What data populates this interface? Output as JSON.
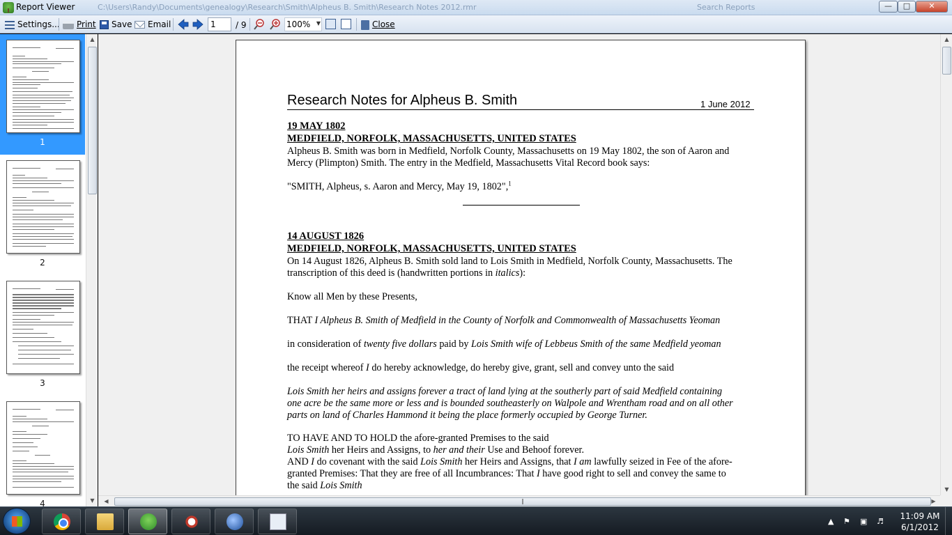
{
  "window": {
    "title": "Report Viewer",
    "path": "C:\\Users\\Randy\\Documents\\genealogy\\Research\\Smith\\Alpheus B. Smith\\Research Notes 2012.rmr",
    "search_text": "Search Reports"
  },
  "toolbar": {
    "settings_label": "Settings...",
    "print_label": "Print",
    "save_label": "Save",
    "email_label": "Email",
    "page_current": "1",
    "page_total": "/ 9",
    "zoom": "100%",
    "close_label": "Close"
  },
  "thumbnails": [
    {
      "label": "1",
      "selected": true
    },
    {
      "label": "2",
      "selected": false
    },
    {
      "label": "3",
      "selected": false
    },
    {
      "label": "4",
      "selected": false
    }
  ],
  "document": {
    "title": "Research Notes for Alpheus B. Smith",
    "date": "1 June 2012",
    "s1_date": "19 MAY 1802",
    "s1_place": "MEDFIELD, NORFOLK, MASSACHUSETTS, UNITED STATES",
    "s1_p1": "Alpheus B. Smith was born in Medfield, Norfolk County, Massachusetts on 19 May 1802, the son of Aaron and",
    "s1_p2": "Mercy (Plimpton) Smith.  The entry in the Medfield, Massachusetts Vital Record book says:",
    "s1_quote": "\"SMITH, Alpheus, s. Aaron and Mercy, May 19, 1802\",",
    "s1_footnote": "1",
    "s2_date": "14 AUGUST 1826",
    "s2_place": "MEDFIELD, NORFOLK, MASSACHUSETTS, UNITED STATES",
    "s2_p1": "On 14 August 1826, Alpheus B. Smith sold land to Lois Smith in Medfield, Norfolk County, Massachusetts.  The",
    "s2_p2a": "transcription of this deed is (handwritten portions in ",
    "s2_p2b": "italics",
    "s2_p2c": "):",
    "know_all": "Know all Men  by these Presents,",
    "that_a": "THAT ",
    "that_b": "I Alpheus B. Smith of Medfield in the County of Norfolk and Commonwealth of Massachusetts Yeoman",
    "consid_a": "in consideration of ",
    "consid_b": "twenty five dollars",
    "consid_c": " paid by ",
    "consid_d": "Lois Smith wife of Lebbeus Smith of the same Medfield yeoman",
    "receipt_a": "the receipt whereof ",
    "receipt_b": "I",
    "receipt_c": " do hereby acknowledge, do hereby give, grant, sell and convey unto the said",
    "lois_1": "Lois Smith her heirs and assigns forever a tract of land lying at the southerly part of said Medfield containing",
    "lois_2": "one acre be the same more or less and is bounded southeasterly on Walpole and Wrentham road and on all other",
    "lois_3": "parts on land of Charles Hammond it being the place formerly occupied by George Turner.",
    "tohave": "TO HAVE AND TO HOLD the afore-granted Premises to the said",
    "heirs_a": "Lois Smith",
    "heirs_b": " her Heirs and Assigns, to ",
    "heirs_c": "her and their",
    "heirs_d": " Use and Behoof forever.",
    "and_a": "AND ",
    "and_b": "I",
    "and_c": " do covenant with the said ",
    "and_d": "Lois Smith",
    "and_e": " her Heirs and Assigns, that ",
    "and_f": "I am",
    "and_g": " lawfully seized in Fee of the afore-",
    "granted_a": "granted Premises: That they are free of all Incumbrances:  That ",
    "granted_b": "I",
    "granted_c": " have good right to sell and convey the same to",
    "said_a": "the said ",
    "said_b": "Lois Smith"
  },
  "taskbar": {
    "time": "11:09 AM",
    "date": "6/1/2012",
    "apps": [
      "chrome-icon",
      "explorer-icon",
      "family-tree-icon",
      "snipping-tool-icon",
      "thunderbird-icon",
      "odf-viewer-icon"
    ]
  }
}
